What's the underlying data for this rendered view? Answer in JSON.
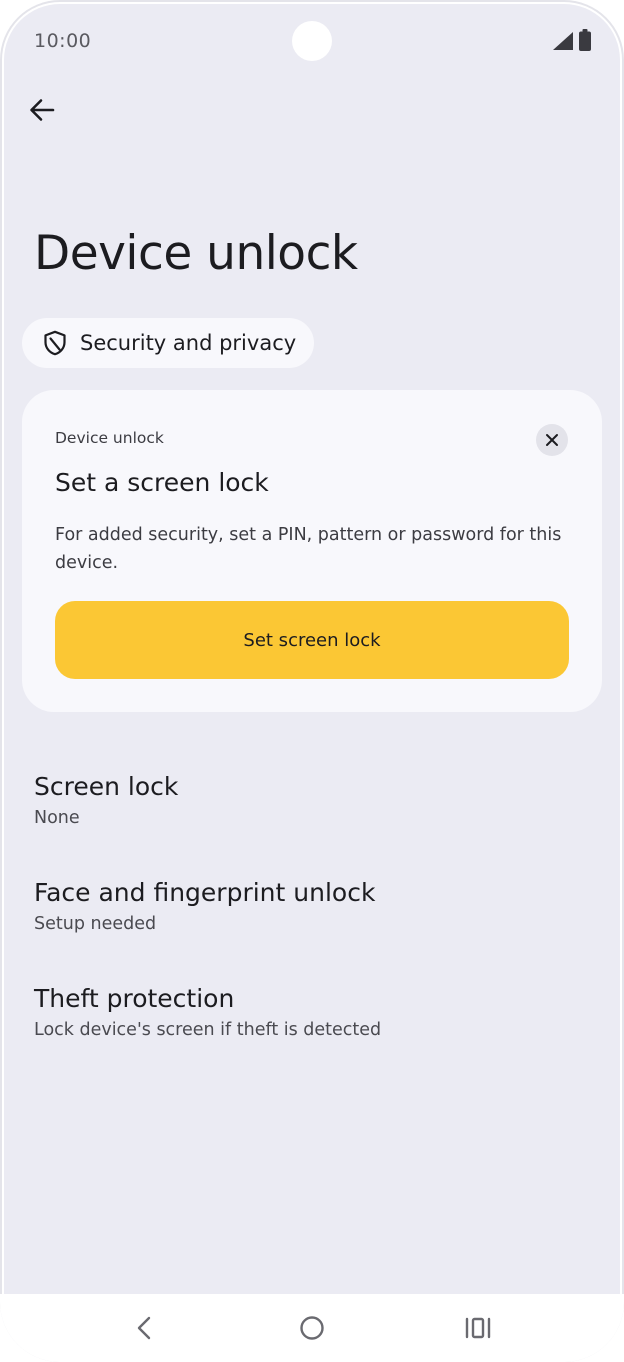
{
  "status_bar": {
    "time": "10:00",
    "icons": [
      "signal-icon",
      "battery-icon"
    ]
  },
  "toolbar": {
    "back_icon": "arrow-back-icon"
  },
  "page": {
    "title": "Device unlock"
  },
  "breadcrumb": {
    "icon": "shield-icon",
    "label": "Security and privacy"
  },
  "suggestion_card": {
    "eyebrow": "Device unlock",
    "title": "Set a screen lock",
    "body": "For added security, set a PIN, pattern or password for this device.",
    "button_label": "Set screen lock",
    "close_icon": "close-icon",
    "accent_color": "#fbc734"
  },
  "settings": {
    "items": [
      {
        "title": "Screen lock",
        "summary": "None"
      },
      {
        "title": "Face and fingerprint unlock",
        "summary": "Setup needed"
      },
      {
        "title": "Theft protection",
        "summary": "Lock device's screen if theft is detected"
      }
    ]
  },
  "nav_bar": {
    "buttons": [
      "back-nav-icon",
      "home-nav-icon",
      "recents-nav-icon"
    ]
  },
  "colors": {
    "background": "#ebebf3",
    "card": "#f8f8fc",
    "text_primary": "#1c1c20",
    "text_secondary": "#4a4a50"
  }
}
